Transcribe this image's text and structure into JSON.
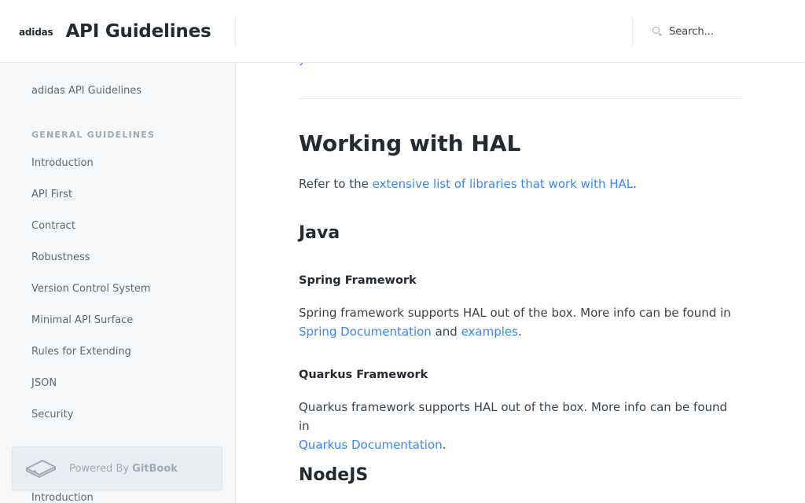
{
  "header": {
    "logo_text": "adidas",
    "title": "API Guidelines",
    "search_placeholder": "Search..."
  },
  "sidebar": {
    "top_item": "adidas API Guidelines",
    "section_general": "GENERAL GUIDELINES",
    "items": [
      "Introduction",
      "API First",
      "Contract",
      "Robustness",
      "Version Control System",
      "Minimal API Surface",
      "Rules for Extending",
      "JSON",
      "Security"
    ],
    "bottom_item": "Introduction",
    "powered_by": "Powered By",
    "gitbook": "GitBook"
  },
  "main": {
    "partial_link": "y",
    "heading": "Working with HAL",
    "intro_prefix": "Refer to the ",
    "intro_link": "extensive list of libraries that work with HAL",
    "intro_suffix": ".",
    "java_heading": "Java",
    "spring": {
      "heading": "Spring Framework",
      "text_line1": "Spring framework supports HAL out of the box. More info can be found in",
      "link1": "Spring Documentation",
      "and": " and ",
      "link2": "examples",
      "suffix": "."
    },
    "quarkus": {
      "heading": "Quarkus Framework",
      "text_line1": "Quarkus framework supports HAL out of the box. More info can be found in",
      "link1": "Quarkus Documentation",
      "suffix": "."
    },
    "nodejs_heading": "NodeJS"
  },
  "colors": {
    "accent": "#3884ff",
    "sidebar_bg": "#f5f7f9",
    "heading": "#242a31",
    "text": "#3b454e"
  }
}
